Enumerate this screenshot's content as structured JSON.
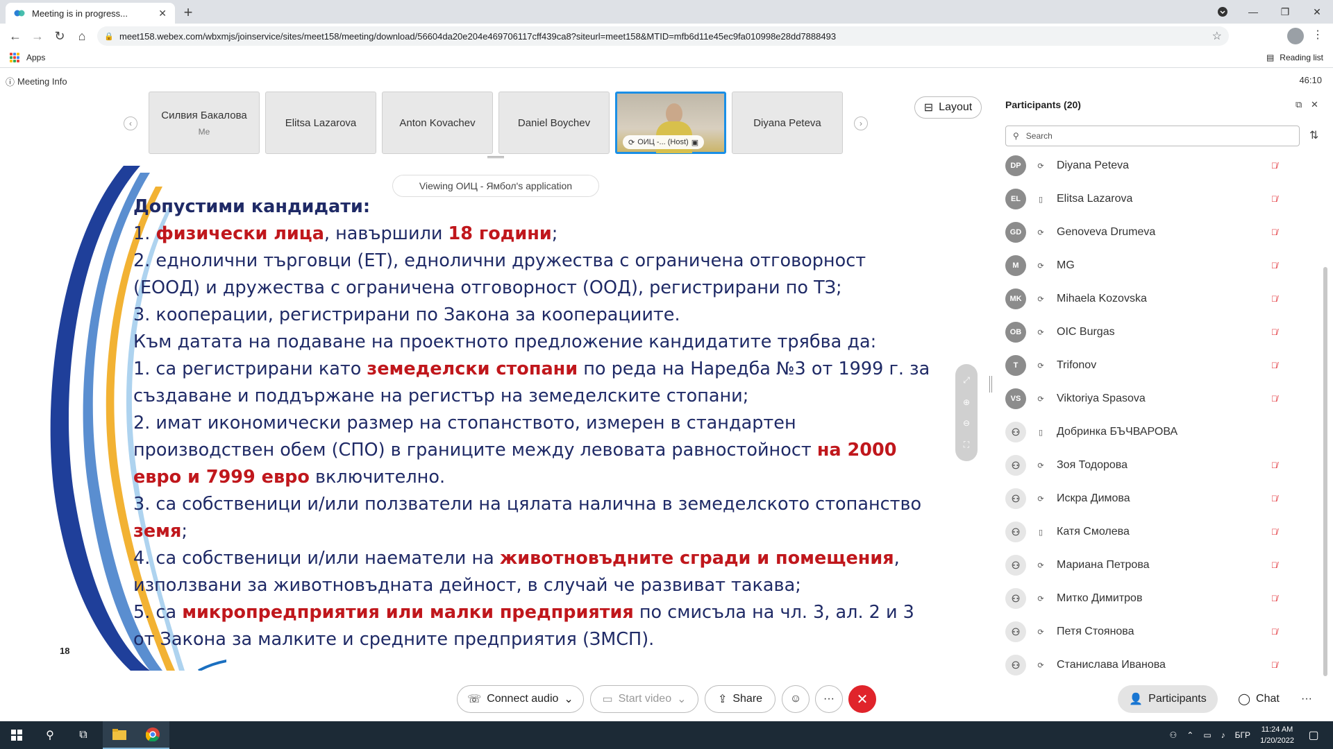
{
  "browser": {
    "tab_title": "Meeting is in progress...",
    "url": "meet158.webex.com/wbxmjs/joinservice/sites/meet158/meeting/download/56604da20e204e469706117cff439ca8?siteurl=meet158&MTID=mfb6d11e45ec9fa010998e28dd7888493",
    "bookmarks_apps": "Apps",
    "reading_list": "Reading list"
  },
  "meeting": {
    "info_label": "Meeting Info",
    "timer": "46:10",
    "layout_label": "Layout",
    "viewing_label": "Viewing ОИЦ - Ямбол's application",
    "thumbnails": [
      {
        "name": "Силвия Бакалова",
        "sub": "Me"
      },
      {
        "name": "Elitsa Lazarova"
      },
      {
        "name": "Anton Kovachev"
      },
      {
        "name": "Daniel Boychev"
      },
      {
        "name": "ОИЦ -... (Host)",
        "video": true
      },
      {
        "name": "Diyana Peteva"
      }
    ]
  },
  "slide": {
    "page_number": "18",
    "heading": "Допустими кандидати:",
    "l1_n": "1. ",
    "l1_r1": "физически лица",
    "l1_t1": ", навършили ",
    "l1_r2": "18 години",
    "l1_t2": ";",
    "l2": "2. еднолични търговци (ЕТ), еднолични дружества с ограничена отговорност (ЕООД) и дружества с ограничена отговорност (ООД), регистрирани по ТЗ;",
    "l3": "3. кооперации, регистрирани по Закона за кооперациите.",
    "l4": "Към датата на подаване на проектното предложение кандидатите трябва да:",
    "l5_t1": "1. са регистрирани като ",
    "l5_r1": "земеделски стопани",
    "l5_t2": " по реда на Наредба №3 от 1999 г. за създаване и поддържане на регистър на земеделските стопани;",
    "l6_t1": "2. имат икономически размер на стопанството, измерен в стандартен производствен обем (СПО) в границите между левовата равностойност ",
    "l6_r1": "на 2000 евро и 7999 евро",
    "l6_t2": " включително.",
    "l7_t1": "3. са собственици и/или ползватели на цялата налична в земеделското стопанство ",
    "l7_r1": "земя",
    "l7_t2": ";",
    "l8_t1": "4. са собственици и/или наематели на ",
    "l8_r1": "животновъдните сгради и помещения",
    "l8_t2": ", използвани за животновъдната дейност, в случай че развиват такава;",
    "l9_t1": "5. са ",
    "l9_r1": "микропредприятия или малки предприятия",
    "l9_t2": " по смисъла на чл. 3, ал. 2 и 3 от Закона за малките и средните предприятия (ЗМСП)."
  },
  "controls": {
    "connect_audio": "Connect audio",
    "start_video": "Start video",
    "share": "Share",
    "more": "···",
    "participants": "Participants",
    "chat": "Chat"
  },
  "participants_panel": {
    "title": "Participants (20)",
    "search_placeholder": "Search",
    "items": [
      {
        "initials": "DP",
        "name": "Diyana Peteva",
        "device": "sync",
        "muted": true
      },
      {
        "initials": "EL",
        "name": "Elitsa Lazarova",
        "device": "phone",
        "muted": true
      },
      {
        "initials": "GD",
        "name": "Genoveva Drumeva",
        "device": "sync",
        "muted": true
      },
      {
        "initials": "M",
        "name": "MG",
        "device": "sync",
        "muted": true
      },
      {
        "initials": "MK",
        "name": "Mihaela Kozovska",
        "device": "sync",
        "muted": true
      },
      {
        "initials": "OB",
        "name": "OIC Burgas",
        "device": "sync",
        "muted": true
      },
      {
        "initials": "T",
        "name": "Trifonov",
        "device": "sync",
        "muted": true
      },
      {
        "initials": "VS",
        "name": "Viktoriya Spasova",
        "device": "sync",
        "muted": true
      },
      {
        "initials": "",
        "name": "Добринка БЪЧВАРОВА",
        "device": "phone",
        "muted": false
      },
      {
        "initials": "",
        "name": "Зоя Тодорова",
        "device": "sync",
        "muted": true
      },
      {
        "initials": "",
        "name": "Искра Димова",
        "device": "sync",
        "muted": true
      },
      {
        "initials": "",
        "name": "Катя Смолева",
        "device": "phone",
        "muted": true
      },
      {
        "initials": "",
        "name": "Мариана Петрова",
        "device": "sync",
        "muted": true
      },
      {
        "initials": "",
        "name": "Митко Димитров",
        "device": "sync",
        "muted": true
      },
      {
        "initials": "",
        "name": "Петя Стоянова",
        "device": "sync",
        "muted": true
      },
      {
        "initials": "",
        "name": "Станислава Иванова",
        "device": "sync",
        "muted": true
      }
    ]
  },
  "taskbar": {
    "language": "БГР",
    "time": "11:24 AM",
    "date": "1/20/2022"
  },
  "colors": {
    "slide_text": "#1f2a66",
    "slide_highlight": "#c0171c",
    "leave_button": "#e0242b",
    "active_video_border": "#1a8fe6"
  }
}
